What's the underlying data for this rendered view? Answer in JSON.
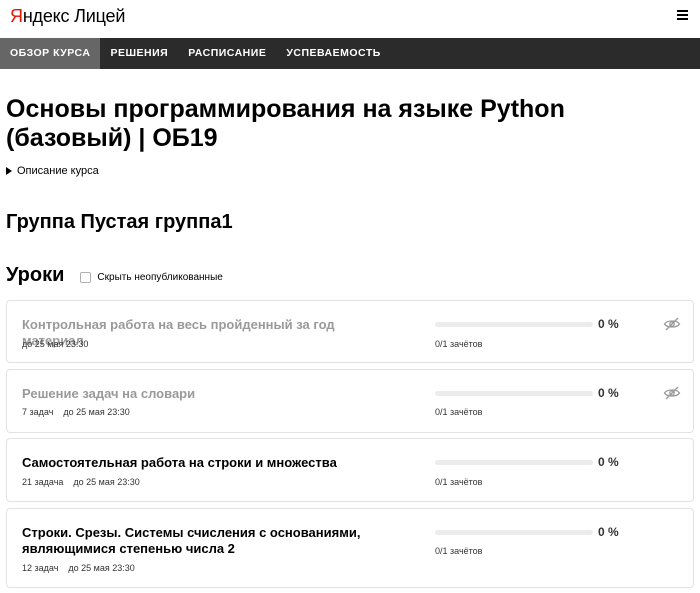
{
  "header": {
    "logo_ya": "Яндекс",
    "logo_lyceum": "Лицей",
    "menu_icon": "hamburger-menu-icon"
  },
  "nav": {
    "items": [
      {
        "label": "ОБЗОР КУРСА",
        "active": true
      },
      {
        "label": "РЕШЕНИЯ",
        "active": false
      },
      {
        "label": "РАСПИСАНИЕ",
        "active": false
      },
      {
        "label": "УСПЕВАЕМОСТЬ",
        "active": false
      }
    ]
  },
  "course": {
    "title": "Основы программирования на языке Python (базовый) | ОБ19",
    "description_toggle": "Описание курса"
  },
  "group": {
    "title": "Группа Пустая группа1"
  },
  "lessons": {
    "title": "Уроки",
    "hide_unpublished_label": "Скрыть неопубликованные",
    "hide_unpublished_checked": false,
    "items": [
      {
        "title": "Контрольная работа на весь пройденный за год материал",
        "tasks": "",
        "deadline": "до 25 мая 23:30",
        "progress": 0,
        "percent": "0 %",
        "credits": "0/1 зачётов",
        "unpublished": true,
        "icon": "eye-crossed-icon"
      },
      {
        "title": "Решение задач на словари",
        "tasks": "7 задач",
        "deadline": "до 25 мая 23:30",
        "progress": 0,
        "percent": "0 %",
        "credits": "0/1 зачётов",
        "unpublished": true,
        "icon": "eye-crossed-icon"
      },
      {
        "title": "Самостоятельная работа на строки и множества",
        "tasks": "21 задача",
        "deadline": "до 25 мая 23:30",
        "progress": 0,
        "percent": "0 %",
        "credits": "0/1 зачётов",
        "unpublished": false
      },
      {
        "title": "Строки. Срезы. Системы счисления с основаниями, являющимися степенью числа 2",
        "tasks": "12 задач",
        "deadline": "до 25 мая 23:30",
        "progress": 0,
        "percent": "0 %",
        "credits": "0/1 зачётов",
        "unpublished": false
      }
    ]
  },
  "colors": {
    "nav_bg": "#2b2b2b",
    "nav_active_bg": "#666666",
    "logo_accent": "#e61400",
    "muted_text": "#9a9a9a",
    "progress_track": "#ececec"
  }
}
